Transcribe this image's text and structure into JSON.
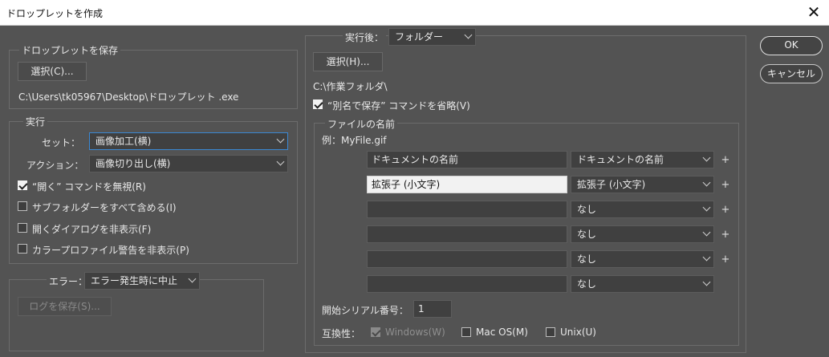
{
  "window": {
    "title": "ドロップレットを作成",
    "close_icon": "close-icon"
  },
  "buttons": {
    "ok": "OK",
    "cancel": "キャンセル"
  },
  "save_group": {
    "legend": "ドロップレットを保存",
    "choose_button": "選択(C)...",
    "path": "C:\\Users\\tk05967\\Desktop\\ドロップレット .exe"
  },
  "run_group": {
    "legend": "実行",
    "set_label": "セット：",
    "set_value": "画像加工(横)",
    "action_label": "アクション：",
    "action_value": "画像切り出し(横)",
    "checkboxes": [
      {
        "label": "“開く” コマンドを無視(R)",
        "checked": true
      },
      {
        "label": "サブフォルダーをすべて含める(I)",
        "checked": false
      },
      {
        "label": "開くダイアログを非表示(F)",
        "checked": false
      },
      {
        "label": "カラープロファイル警告を非表示(P)",
        "checked": false
      }
    ]
  },
  "error_group": {
    "label": "エラー：",
    "value": "エラー発生時に中止",
    "log_button": "ログを保存(S)..."
  },
  "dest_group": {
    "label": "実行後：",
    "value": "フォルダー",
    "choose_button": "選択(H)...",
    "path": "C:\\作業フォルダ\\",
    "omit_save_as": {
      "label": "“別名で保存” コマンドを省略(V)",
      "checked": true
    }
  },
  "naming_group": {
    "legend": "ファイルの名前",
    "example": "例：MyFile.gif",
    "rows": [
      {
        "input": "ドキュメントの名前",
        "select": "ドキュメントの名前",
        "plus": "+"
      },
      {
        "input": "拡張子 (小文字)",
        "select": "拡張子 (小文字)",
        "plus": "+"
      },
      {
        "input": "",
        "select": "なし",
        "plus": "+"
      },
      {
        "input": "",
        "select": "なし",
        "plus": "+"
      },
      {
        "input": "",
        "select": "なし",
        "plus": "+"
      },
      {
        "input": "",
        "select": "なし",
        "plus": ""
      }
    ],
    "serial_label": "開始シリアル番号：",
    "serial_value": "1",
    "compat_label": "互換性：",
    "compat": [
      {
        "label": "Windows(W)",
        "checked": true,
        "disabled": true
      },
      {
        "label": "Mac OS(M)",
        "checked": false,
        "disabled": false
      },
      {
        "label": "Unix(U)",
        "checked": false,
        "disabled": false
      }
    ]
  }
}
